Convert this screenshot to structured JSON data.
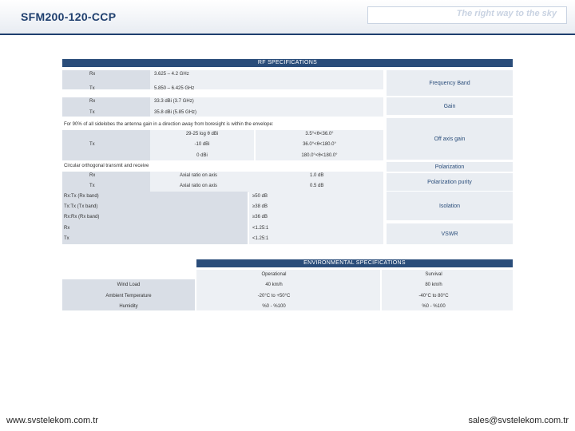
{
  "header": {
    "title": "SFM200-120-CCP",
    "slogan": "The right way to the sky"
  },
  "rf": {
    "section_title": "RF SPECIFICATIONS",
    "freq": {
      "rx_label": "Rx",
      "rx_value": "3.625 – 4.2 GHz",
      "tx_label": "Tx",
      "tx_value": "5.850 – 6.425 GHz",
      "right_label": "Frequency Band"
    },
    "gain": {
      "rx_label": "Rx",
      "rx_value": "33.3 dBi (3.7 GHz)",
      "tx_label": "Tx",
      "tx_value": "35.8 dBi (5.85 GHz)",
      "right_label": "Gain"
    },
    "offaxis": {
      "note": "For 90% of all sidelobes the antenna gain in a direction away from boresight is within the envelope:",
      "tx_label": "Tx",
      "rows": [
        [
          "29-25 log θ dBi",
          "3.5°<θ<36.0°"
        ],
        [
          "-10 dBi",
          "36.0°<θ<180.0°"
        ],
        [
          "0 dBi",
          "180.0°<θ<180.0°"
        ]
      ],
      "right_label": "Off axis gain"
    },
    "polarization": {
      "label": "Circular orthogonal transmit and receive",
      "right_label": "Polarization"
    },
    "purity": {
      "rows": [
        [
          "Rx",
          "Axial ratio on axis",
          "1.0 dB"
        ],
        [
          "Tx",
          "Axial ratio on axis",
          "0.5 dB"
        ]
      ],
      "right_label": "Polarization purity"
    },
    "isolation": {
      "rows": [
        [
          "Rx:Tx (Rx band)",
          "≥50 dB"
        ],
        [
          "Tx:Tx (Tx band)",
          "≥38 dB"
        ],
        [
          "Rx:Rx (Rx band)",
          "≥36 dB"
        ]
      ],
      "right_label": "Isolation"
    },
    "vswr": {
      "rows": [
        [
          "Rx",
          "<1.25:1"
        ],
        [
          "Tx",
          "<1.25:1"
        ]
      ],
      "right_label": "VSWR"
    }
  },
  "env": {
    "section_title": "ENVIRONMENTAL SPECIFICATIONS",
    "col_operational": "Operational",
    "col_survival": "Survival",
    "rows": [
      [
        "Wind Load",
        "40 km/h",
        "80 km/h"
      ],
      [
        "Ambient Temperature",
        "-20°C to +50°C",
        "-40°C to 80°C"
      ],
      [
        "Humidity",
        "%0 - %100",
        "%0 - %100"
      ]
    ]
  },
  "footer": {
    "website": "www.svstelekom.com.tr",
    "email": "sales@svstelekom.com.tr"
  }
}
